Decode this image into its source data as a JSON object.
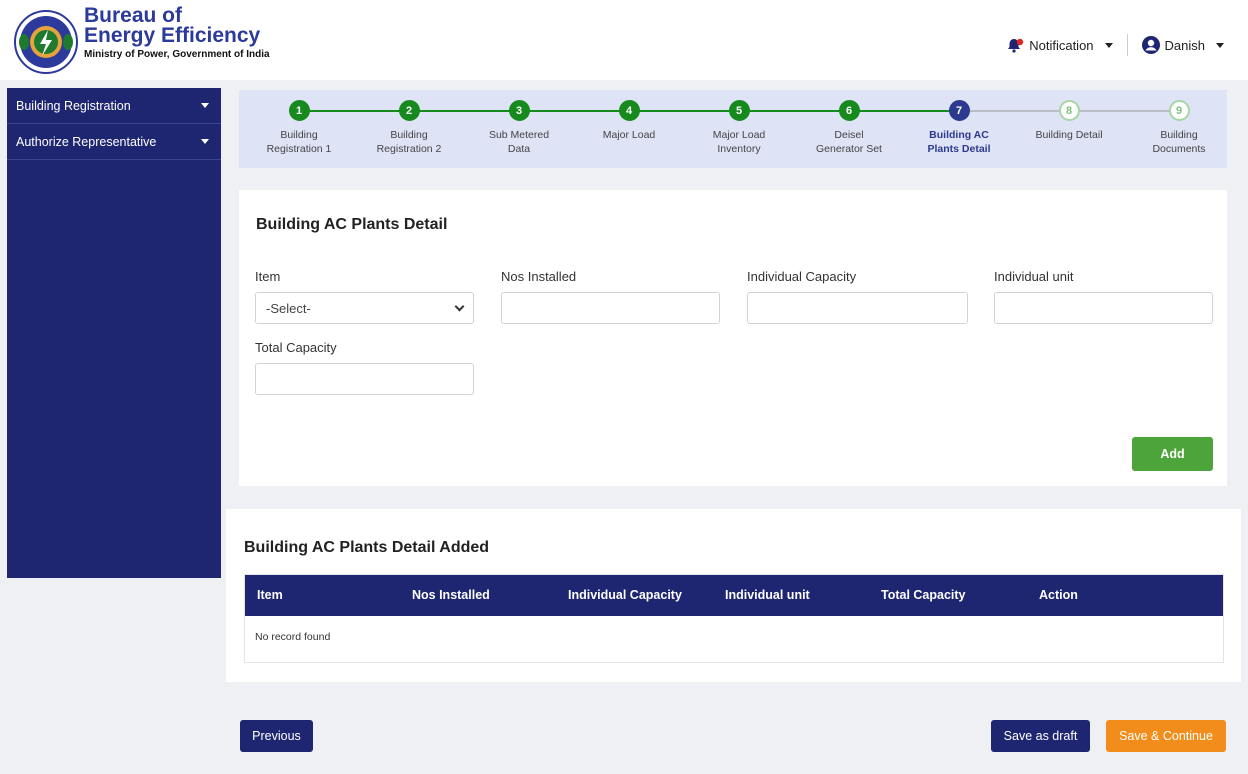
{
  "header": {
    "brand_line1": "Bureau of",
    "brand_line2": "Energy Efficiency",
    "brand_sub": "Ministry of Power, Government of India",
    "notification_label": "Notification",
    "user_label": "Danish",
    "icons": {
      "notification": "bell-icon",
      "user": "user-circle-icon",
      "logo": "bee-logo"
    }
  },
  "sidebar": {
    "items": [
      {
        "label": "Building Registration"
      },
      {
        "label": "Authorize Representative"
      }
    ]
  },
  "stepper": {
    "steps": [
      {
        "num": "1",
        "line1": "Building",
        "line2": "Registration 1",
        "state": "done"
      },
      {
        "num": "2",
        "line1": "Building",
        "line2": "Registration 2",
        "state": "done"
      },
      {
        "num": "3",
        "line1": "Sub Metered",
        "line2": "Data",
        "state": "done"
      },
      {
        "num": "4",
        "line1": "Major Load",
        "line2": "",
        "state": "done"
      },
      {
        "num": "5",
        "line1": "Major Load",
        "line2": "Inventory",
        "state": "done"
      },
      {
        "num": "6",
        "line1": "Deisel",
        "line2": "Generator Set",
        "state": "done"
      },
      {
        "num": "7",
        "line1": "Building AC",
        "line2": "Plants Detail",
        "state": "active"
      },
      {
        "num": "8",
        "line1": "Building Detail",
        "line2": "",
        "state": "todo"
      },
      {
        "num": "9",
        "line1": "Building",
        "line2": "Documents",
        "state": "todo"
      }
    ]
  },
  "form": {
    "title": "Building AC Plants Detail",
    "item_label": "Item",
    "item_value": "-Select-",
    "nos_label": "Nos Installed",
    "nos_value": "",
    "capacity_label": "Individual Capacity",
    "capacity_value": "",
    "unit_label": "Individual unit",
    "unit_value": "",
    "total_label": "Total Capacity",
    "total_value": "",
    "add_label": "Add"
  },
  "table": {
    "title": "Building AC Plants Detail Added",
    "columns": [
      "Item",
      "Nos Installed",
      "Individual Capacity",
      "Individual unit",
      "Total Capacity",
      "Action"
    ],
    "empty_text": "No record found"
  },
  "actions": {
    "previous_label": "Previous",
    "draft_label": "Save as draft",
    "continue_label": "Save & Continue"
  },
  "colors": {
    "navy": "#1e2672",
    "done_green": "#178a1e",
    "add_green": "#4da43a",
    "orange": "#f28c1a",
    "stepper_bg": "#dfe3f6"
  }
}
